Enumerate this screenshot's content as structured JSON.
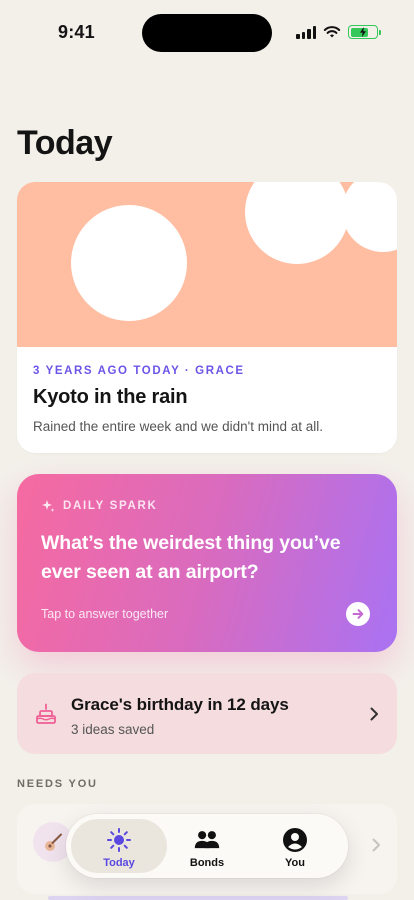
{
  "status": {
    "time": "9:41"
  },
  "page": {
    "title": "Today"
  },
  "memory": {
    "meta": "3 YEARS AGO TODAY · GRACE",
    "title": "Kyoto in the rain",
    "description": "Rained the entire week and we didn't mind at all.",
    "hero_color": "#ffbea2"
  },
  "spark": {
    "label": "DAILY SPARK",
    "question": "What’s the weirdest thing you’ve ever seen at an airport?",
    "cta": "Tap to answer together",
    "icon": "sparkle-icon",
    "gradient": [
      "#f66aa0",
      "#a972f3"
    ]
  },
  "birthday": {
    "title": "Grace's birthday in 12 days",
    "subtitle": "3 ideas saved",
    "icon": "cake-icon"
  },
  "needs_you": {
    "label": "NEEDS YOU",
    "item_icon": "guitar-icon"
  },
  "tabs": [
    {
      "label": "Today",
      "icon": "sun-icon",
      "active": true
    },
    {
      "label": "Bonds",
      "icon": "people-icon",
      "active": false
    },
    {
      "label": "You",
      "icon": "profile-icon",
      "active": false
    }
  ],
  "colors": {
    "accent": "#5a48e0",
    "meta_purple": "#6b55e8",
    "background": "#f3f0ea"
  }
}
